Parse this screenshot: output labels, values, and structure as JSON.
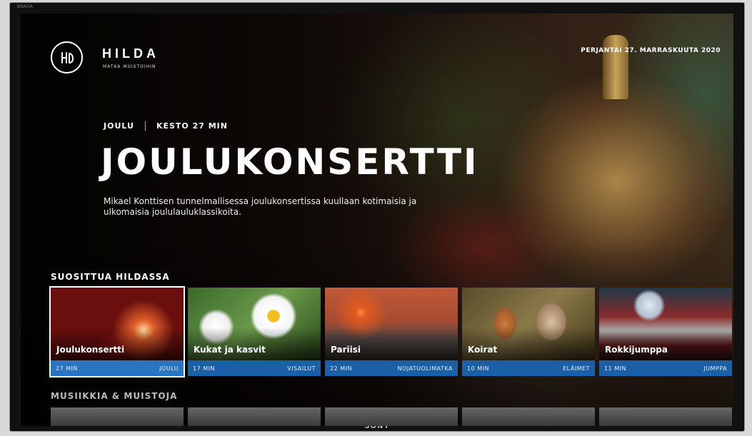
{
  "tv": {
    "brand": "SONY",
    "corner_label": "BRAVIA"
  },
  "header": {
    "logo_name": "HILDA",
    "logo_tagline": "MATKA MUISTOIHIN",
    "date": "PERJANTAI 27. MARRASKUUTA 2020"
  },
  "hero": {
    "category": "JOULU",
    "duration": "KESTO 27 MIN",
    "title": "JOULUKONSERTTI",
    "description": "Mikael Konttisen tunnelmallisessa joulukonsertissa kuullaan kotimaisia ja ulkomaisia joululauluklassikoita."
  },
  "rows": [
    {
      "title": "SUOSITTUA HILDASSA",
      "items": [
        {
          "title": "Joulukonsertti",
          "duration": "27 MIN",
          "category": "JOULU"
        },
        {
          "title": "Kukat ja kasvit",
          "duration": "17 MIN",
          "category": "VISAILUT"
        },
        {
          "title": "Pariisi",
          "duration": "22 MIN",
          "category": "NOJATUOLIMATKA"
        },
        {
          "title": "Koirat",
          "duration": "10 MIN",
          "category": "ELÄIMET"
        },
        {
          "title": "Rokkijumppa",
          "duration": "11 MIN",
          "category": "JUMPPA"
        }
      ]
    },
    {
      "title": "MUSIIKKIA & MUISTOJA"
    }
  ],
  "colors": {
    "accent_bar": "#1b5fa6"
  }
}
